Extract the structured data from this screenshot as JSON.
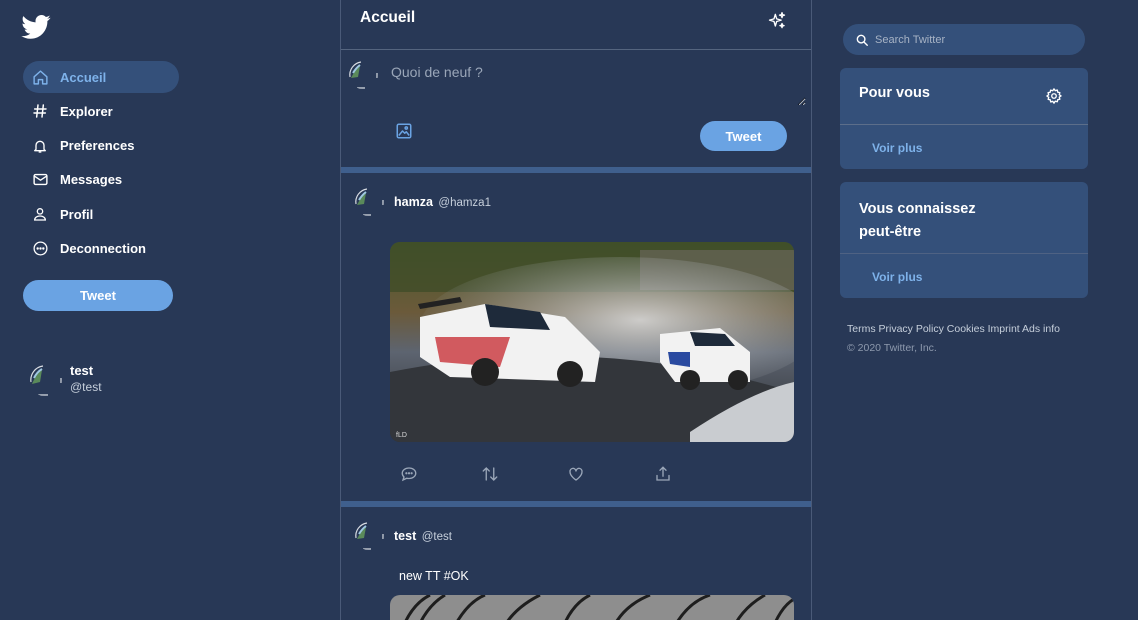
{
  "brand": {
    "logo_icon": "twitter-bird-icon",
    "accent": "#6aa3e3",
    "link": "#7eb2ea",
    "background": "#283856",
    "card": "#34507a"
  },
  "sidebar": {
    "items": [
      {
        "label": "Accueil",
        "icon": "home-icon",
        "active": true
      },
      {
        "label": "Explorer",
        "icon": "hashtag-icon",
        "active": false
      },
      {
        "label": "Preferences",
        "icon": "bell-icon",
        "active": false
      },
      {
        "label": "Messages",
        "icon": "envelope-icon",
        "active": false
      },
      {
        "label": "Profil",
        "icon": "user-icon",
        "active": false
      },
      {
        "label": "Deconnection",
        "icon": "more-circle-icon",
        "active": false
      }
    ],
    "tweet_button": "Tweet",
    "profile": {
      "name": "test",
      "handle": "@test"
    }
  },
  "main": {
    "header_title": "Accueil",
    "composer": {
      "placeholder": "Quoi de neuf ?",
      "tweet_button": "Tweet"
    },
    "tweets": [
      {
        "name": "hamza",
        "handle": "@hamza1",
        "text": "",
        "media": "drift-cars-photo"
      },
      {
        "name": "test",
        "handle": "@test",
        "text": "new TT #OK",
        "media": "tire-tracks-photo"
      }
    ]
  },
  "right": {
    "search_placeholder": "Search Twitter",
    "for_you": {
      "title": "Pour vous",
      "more": "Voir plus"
    },
    "know": {
      "title": "Vous connaissez peut-être",
      "more": "Voir plus"
    },
    "footer_links": "Terms Privacy Policy Cookies Imprint Ads info",
    "copyright": "© 2020 Twitter, Inc."
  }
}
